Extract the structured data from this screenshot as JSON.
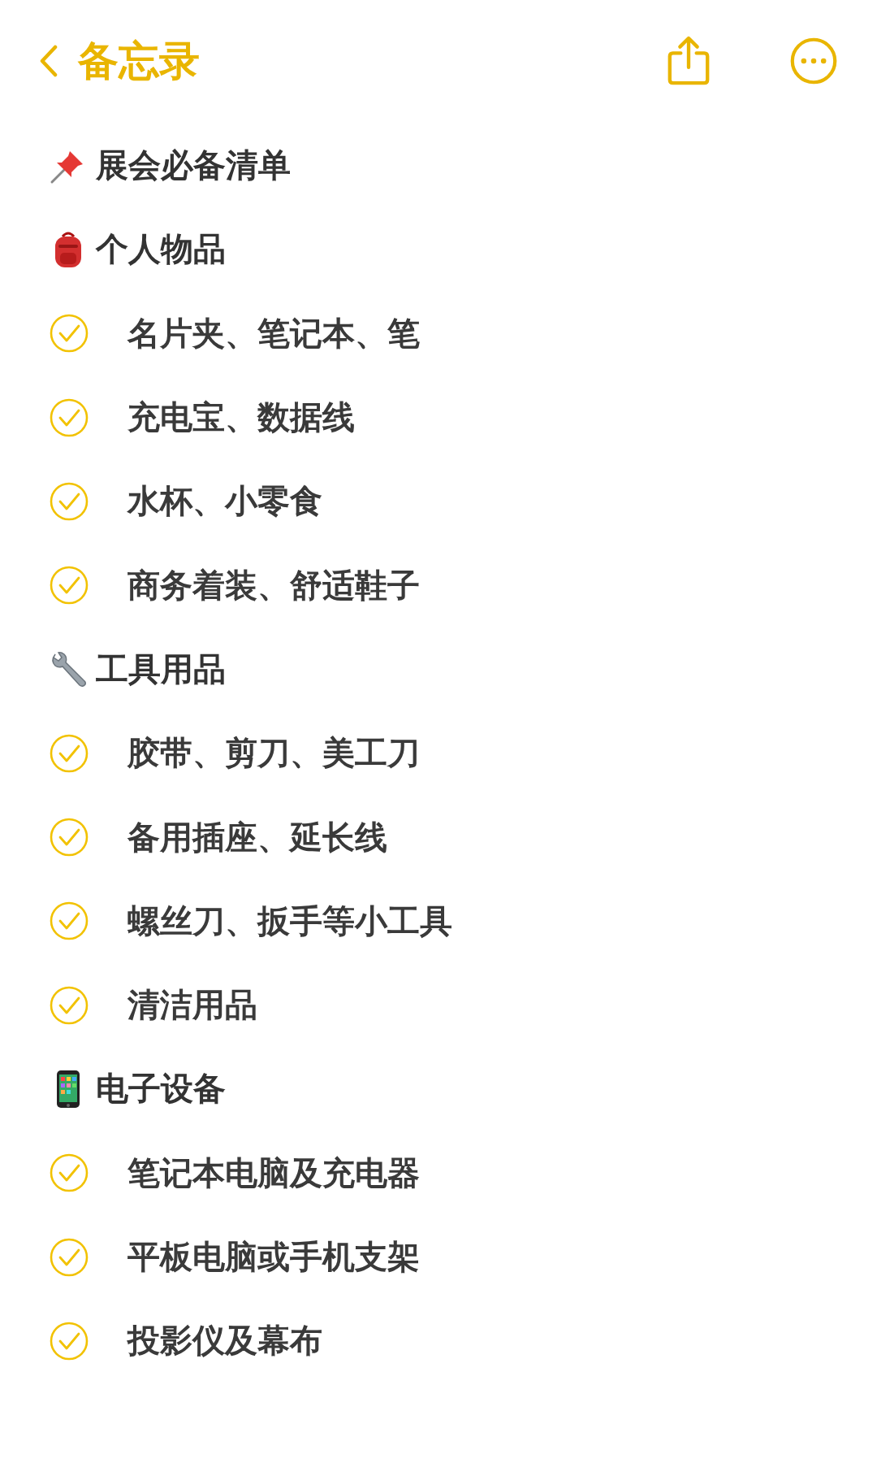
{
  "nav": {
    "back_label": "备忘录"
  },
  "note": {
    "title": "展会必备清单",
    "sections": [
      {
        "title": "个人物品",
        "items": [
          {
            "text": "名片夹、笔记本、笔",
            "checked": true
          },
          {
            "text": "充电宝、数据线",
            "checked": true
          },
          {
            "text": "水杯、小零食",
            "checked": true
          },
          {
            "text": "商务着装、舒适鞋子",
            "checked": true
          }
        ]
      },
      {
        "title": "工具用品",
        "items": [
          {
            "text": "胶带、剪刀、美工刀",
            "checked": true
          },
          {
            "text": "备用插座、延长线",
            "checked": true
          },
          {
            "text": "螺丝刀、扳手等小工具",
            "checked": true
          },
          {
            "text": "清洁用品",
            "checked": true
          }
        ]
      },
      {
        "title": "电子设备",
        "items": [
          {
            "text": "笔记本电脑及充电器",
            "checked": true
          },
          {
            "text": "平板电脑或手机支架",
            "checked": true
          },
          {
            "text": "投影仪及幕布",
            "checked": true
          }
        ]
      }
    ]
  }
}
